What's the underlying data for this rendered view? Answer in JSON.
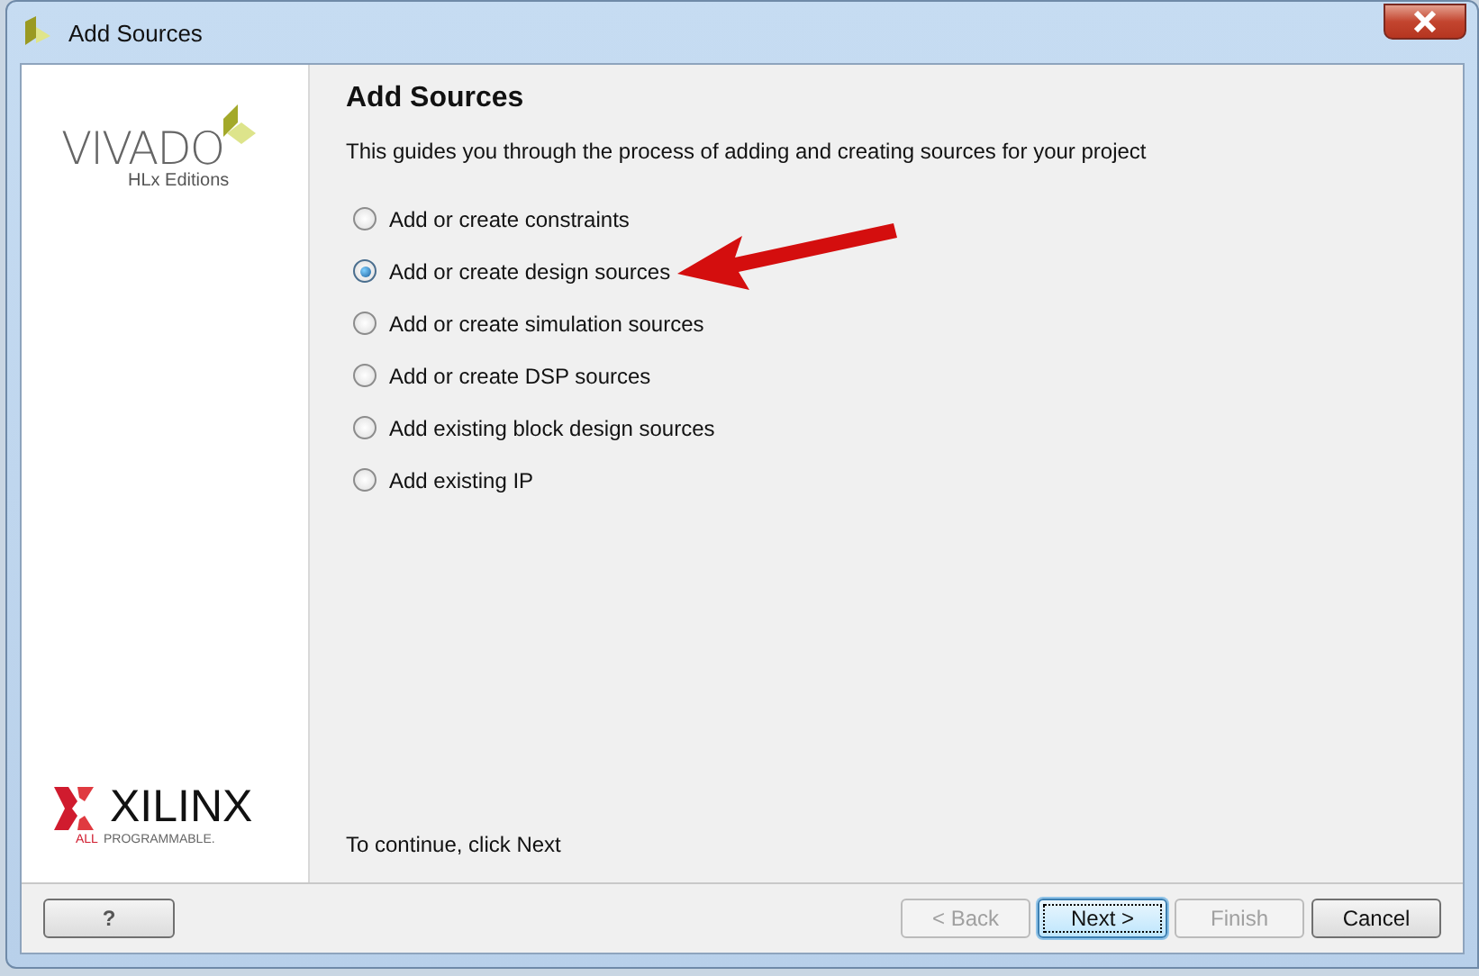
{
  "window": {
    "title": "Add Sources"
  },
  "branding": {
    "product": "VIVADO",
    "edition": "HLx Editions",
    "company": "XILINX",
    "tagline_accent": "ALL",
    "tagline": "PROGRAMMABLE."
  },
  "page": {
    "heading": "Add Sources",
    "description": "This guides you through the process of adding and creating sources for your project",
    "options": [
      {
        "label": "Add or create constraints",
        "selected": false
      },
      {
        "label": "Add or create design sources",
        "selected": true
      },
      {
        "label": "Add or create simulation sources",
        "selected": false
      },
      {
        "label": "Add or create DSP sources",
        "selected": false
      },
      {
        "label": "Add existing block design sources",
        "selected": false
      },
      {
        "label": "Add existing IP",
        "selected": false
      }
    ],
    "hint": "To continue, click Next"
  },
  "buttons": [
    {
      "label": "?",
      "kind": "help"
    },
    {
      "label": "< Back",
      "kind": "nav",
      "disabled": true,
      "default": false
    },
    {
      "label": "Next >",
      "kind": "nav",
      "disabled": false,
      "default": true
    },
    {
      "label": "Finish",
      "kind": "nav",
      "disabled": true,
      "default": false
    },
    {
      "label": "Cancel",
      "kind": "nav",
      "disabled": false,
      "default": false
    }
  ]
}
